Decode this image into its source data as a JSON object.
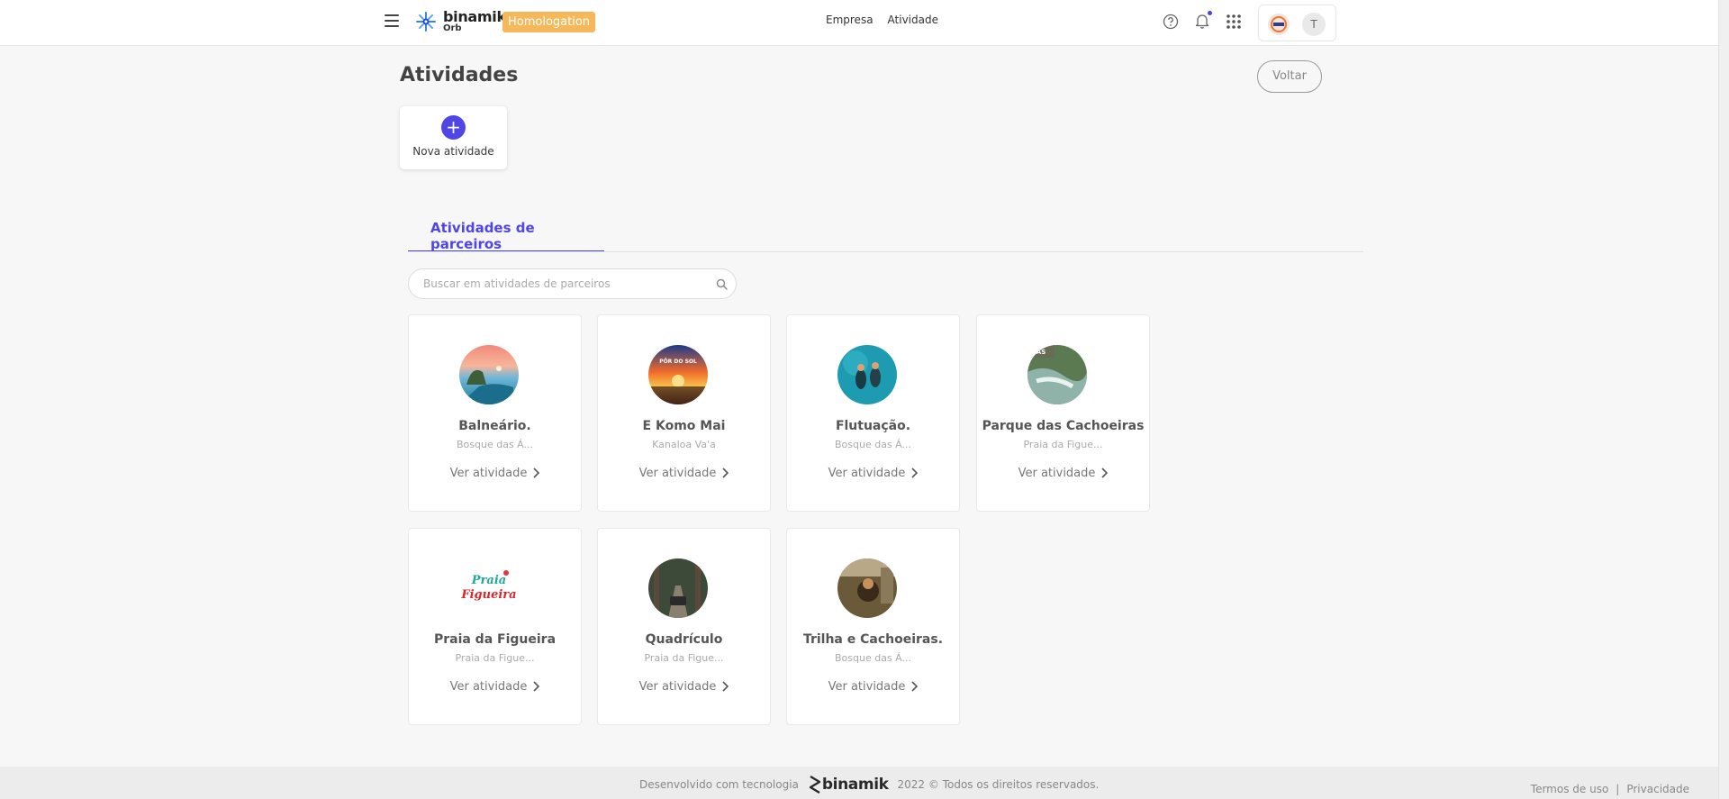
{
  "header": {
    "logo_name": "binamik",
    "logo_sub": "Orb",
    "env_badge": "Homologation",
    "nav": [
      "Empresa",
      "Atividade"
    ],
    "user_initial": "T"
  },
  "page": {
    "title": "Atividades",
    "back_label": "Voltar",
    "new_activity_label": "Nova atividade"
  },
  "tabs": [
    {
      "label": "Atividades de parceiros",
      "active": true
    }
  ],
  "search": {
    "placeholder": "Buscar em atividades de parceiros",
    "value": ""
  },
  "activities": [
    {
      "title": "Balneário.",
      "subtitle": "Bosque das Á...",
      "link": "Ver atividade",
      "thumb": "coastal-rock-sunset"
    },
    {
      "title": "E Komo Mai",
      "subtitle": "Kanaloa Va'a",
      "link": "Ver atividade",
      "thumb": "por-do-sol-poster",
      "thumb_text": "PÔR DO SOL"
    },
    {
      "title": "Flutuação.",
      "subtitle": "Bosque das Á...",
      "link": "Ver atividade",
      "thumb": "underwater-swimmers"
    },
    {
      "title": "Parque das Cachoeiras",
      "subtitle": "Praia da Figue...",
      "link": "Ver atividade",
      "thumb": "waterfall-river",
      "thumb_text": "DAS"
    },
    {
      "title": "Praia da Figueira",
      "subtitle": "Praia da Figue...",
      "link": "Ver atividade",
      "thumb": "praia-da-figueira-logo",
      "thumb_text_1": "Praia",
      "thumb_text_2": "Figueira"
    },
    {
      "title": "Quadrículo",
      "subtitle": "Praia da Figue...",
      "link": "Ver atividade",
      "thumb": "forest-road-vehicle"
    },
    {
      "title": "Trilha e Cachoeiras.",
      "subtitle": "Bosque das Á...",
      "link": "Ver atividade",
      "thumb": "forest-trail-hiker"
    }
  ],
  "footer": {
    "developed_by": "Desenvolvido com tecnologia",
    "brand": "binamik",
    "copyright": "2022 © Todos os direitos reservados.",
    "terms": "Termos de uso",
    "separator": "|",
    "privacy": "Privacidade"
  },
  "colors": {
    "accent": "#4f46e5",
    "badge": "#f5b85a",
    "background": "#f7f7f7"
  }
}
